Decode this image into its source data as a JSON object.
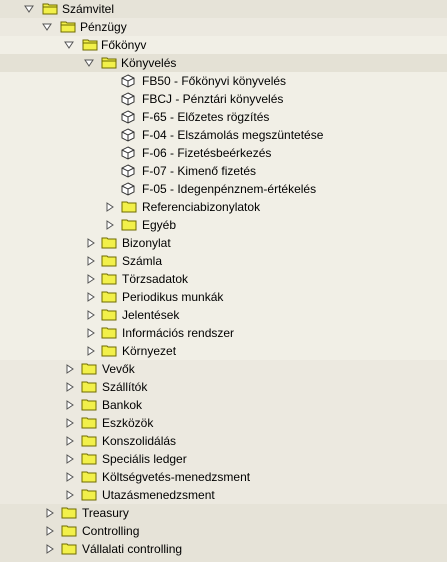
{
  "tree": {
    "root": {
      "label": "Számvitel"
    },
    "penzugy": {
      "label": "Pénzügy"
    },
    "fokonyv": {
      "label": "Főkönyv"
    },
    "konyveles": {
      "label": "Könyvelés",
      "transactions": [
        {
          "label": "FB50 - Főkönyvi könyvelés"
        },
        {
          "label": "FBCJ - Pénztári könyvelés"
        },
        {
          "label": "F-65 - Előzetes rögzítés"
        },
        {
          "label": "F-04 - Elszámolás megszüntetése"
        },
        {
          "label": "F-06 - Fizetésbeérkezés"
        },
        {
          "label": "F-07 - Kimenő fizetés"
        },
        {
          "label": "F-05 - Idegenpénznem-értékelés"
        }
      ],
      "subfolders": [
        {
          "label": "Referenciabizonylatok"
        },
        {
          "label": "Egyéb"
        }
      ]
    },
    "fokonyv_folders": [
      {
        "label": "Bizonylat"
      },
      {
        "label": "Számla"
      },
      {
        "label": "Törzsadatok"
      },
      {
        "label": "Periodikus munkák"
      },
      {
        "label": "Jelentések"
      },
      {
        "label": "Információs rendszer"
      },
      {
        "label": "Környezet"
      }
    ],
    "penzugy_folders": [
      {
        "label": "Vevők"
      },
      {
        "label": "Szállítók"
      },
      {
        "label": "Bankok"
      },
      {
        "label": "Eszközök"
      },
      {
        "label": "Konszolidálás"
      },
      {
        "label": "Speciális ledger"
      },
      {
        "label": "Költségvetés-menedzsment"
      },
      {
        "label": "Utazásmenedzsment"
      }
    ],
    "top_folders": [
      {
        "label": "Treasury"
      },
      {
        "label": "Controlling"
      },
      {
        "label": "Vállalati controlling"
      }
    ]
  },
  "colors": {
    "background": "#ffffff",
    "level1_band": "#e6e3d8",
    "level2_band": "#ece9e0",
    "level3_band": "#f1efe6",
    "selected_band": "#e4e1d5",
    "folder_fill": "#f2f04a",
    "folder_stroke": "#6f6b00"
  }
}
